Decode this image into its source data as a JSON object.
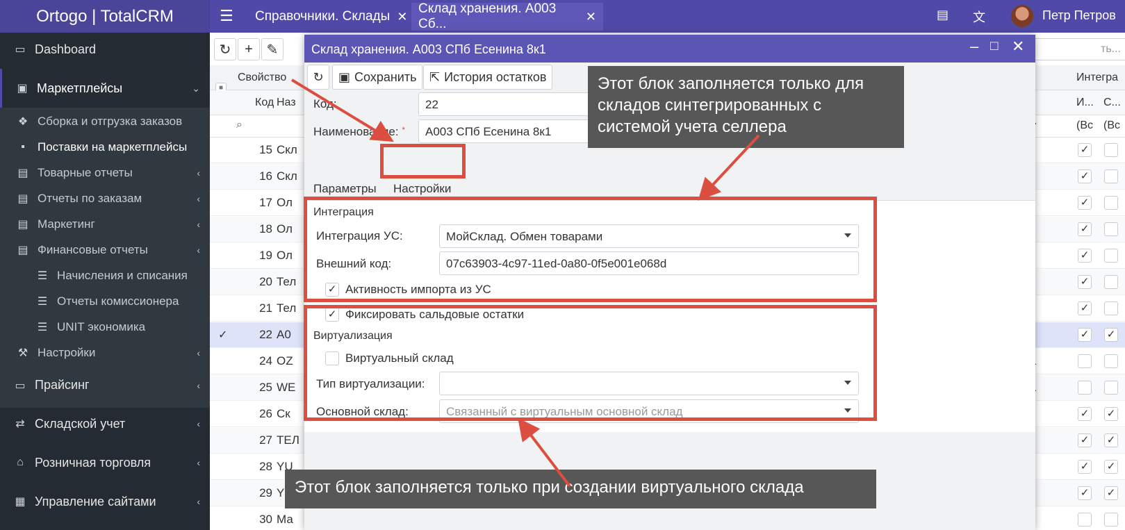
{
  "brand": "Ortogo | TotalCRM",
  "tabs": [
    {
      "label": "Справочники. Склады"
    },
    {
      "label": "Склад хранения. А003 Сб..."
    }
  ],
  "user": {
    "name": "Петр Петров"
  },
  "sidebar": {
    "dashboard": "Dashboard",
    "marketplaces": "Маркетплейсы",
    "sub": [
      {
        "label": "Сборка и отгрузка заказов"
      },
      {
        "label": "Поставки на маркетплейсы"
      },
      {
        "label": "Товарные отчеты"
      },
      {
        "label": "Отчеты по заказам"
      },
      {
        "label": "Маркетинг"
      },
      {
        "label": "Финансовые отчеты"
      },
      {
        "label": "Начисления и списания"
      },
      {
        "label": "Отчеты комиссионера"
      },
      {
        "label": "UNIT экономика"
      },
      {
        "label": "Настройки"
      }
    ],
    "pricing": "Прайсинг",
    "warehouse": "Складской учет",
    "retail": "Розничная торговля",
    "sites": "Управление сайтами"
  },
  "grid": {
    "search_placeholder": "ть...",
    "head_properties": "Свойство",
    "head_integration": "Интегра",
    "col_code": "Код",
    "col_name": "Наз",
    "col_i": "И...",
    "col_s": "С...",
    "filter_all_1": "(Вс",
    "filter_all_2": "(Вс",
    "rows": [
      {
        "code": "15",
        "name": "Скл",
        "right": ""
      },
      {
        "code": "16",
        "name": "Скл",
        "right": ""
      },
      {
        "code": "17",
        "name": "Ол",
        "right": ""
      },
      {
        "code": "18",
        "name": "Ол",
        "right": ""
      },
      {
        "code": "19",
        "name": "Ол",
        "right": ""
      },
      {
        "code": "20",
        "name": "Тел",
        "right": ""
      },
      {
        "code": "21",
        "name": "Тел",
        "right": ""
      },
      {
        "code": "22",
        "name": "А0",
        "right": ""
      },
      {
        "code": "24",
        "name": "OZ",
        "right": "на 8к1"
      },
      {
        "code": "25",
        "name": "WE",
        "right": "на 8к1"
      },
      {
        "code": "26",
        "name": "Ск",
        "right": ""
      },
      {
        "code": "27",
        "name": "ТЕЛ",
        "right": ""
      },
      {
        "code": "28",
        "name": "YU",
        "right": ""
      },
      {
        "code": "29",
        "name": "YU",
        "right": ""
      },
      {
        "code": "30",
        "name": "Ма",
        "right": ""
      }
    ]
  },
  "modal": {
    "title": "Склад хранения. А003 СПб Есенина 8к1",
    "save_label": "Сохранить",
    "history_label": "История остатков",
    "code_label": "Код:",
    "code_value": "22",
    "name_label": "Наименование:",
    "name_value": "А003 СПб Есенина 8к1",
    "tab_params": "Параметры",
    "tab_settings": "Настройки",
    "integration_section": "Интеграция",
    "integration_label": "Интеграция УС:",
    "integration_value": "МойСклад. Обмен товарами",
    "external_code_label": "Внешний код:",
    "external_code_value": "07c63903-4c97-11ed-0a80-0f5e001e068d",
    "import_active_label": "Активность импорта из УС",
    "fix_balance_label": "Фиксировать сальдовые остатки",
    "virtual_section": "Виртуализация",
    "virtual_label": "Виртуальный склад",
    "virt_type_label": "Тип виртуализации:",
    "main_warehouse_label": "Основной склад:",
    "main_warehouse_placeholder": "Связанный с виртуальным основной склад"
  },
  "annotations": {
    "top": "Этот блок заполняется только для складов синтегрированных с системой учета селлера",
    "bottom": "Этот блок заполняется только при создании виртуального склада"
  },
  "colors": {
    "accent": "#5b56b5",
    "annotation_red": "#dc4e3f",
    "sidebar_bg": "#252b32"
  }
}
